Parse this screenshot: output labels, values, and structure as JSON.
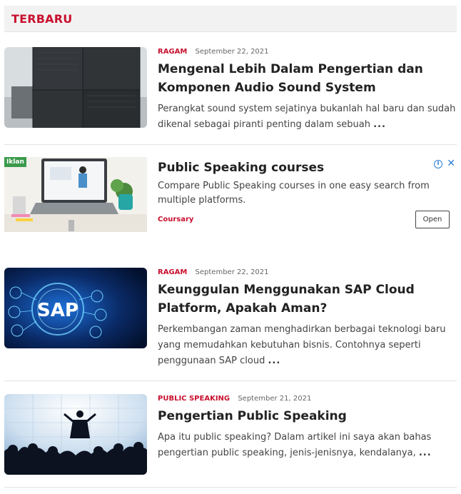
{
  "section": {
    "title": "TERBARU"
  },
  "articles": [
    {
      "category": "RAGAM",
      "date": "September 22, 2021",
      "title": "Mengenal Lebih Dalam Pengertian dan Komponen Audio Sound System",
      "excerpt": "Perangkat sound system sejatinya bukanlah hal baru dan sudah dikenal sebagai piranti penting dalam sebuah",
      "more": "..."
    },
    {
      "category": "RAGAM",
      "date": "September 22, 2021",
      "title": "Keunggulan Menggunakan SAP Cloud Platform, Apakah Aman?",
      "excerpt": "Perkembangan zaman menghadirkan berbagai teknologi baru yang memudahkan kebutuhan bisnis. Contohnya seperti penggunaan SAP cloud",
      "more": "...",
      "image_text": "SAP"
    },
    {
      "category": "PUBLIC SPEAKING",
      "date": "September 21, 2021",
      "title": "Pengertian Public Speaking",
      "excerpt": "Apa itu public speaking? Dalam artikel ini saya akan bahas pengertian public speaking, jenis-jenisnya, kendalanya,",
      "more": "..."
    }
  ],
  "ad": {
    "tag": "Iklan",
    "title": "Public Speaking courses",
    "description": "Compare Public Speaking courses in one easy search from multiple platforms.",
    "advertiser": "Coursary",
    "button_label": "Open",
    "info_icon": "i",
    "close_icon": "✕"
  },
  "colors": {
    "accent": "#c8102e",
    "ad_blue": "#2d7fd3",
    "ad_tag_green": "#3a9a4c"
  }
}
